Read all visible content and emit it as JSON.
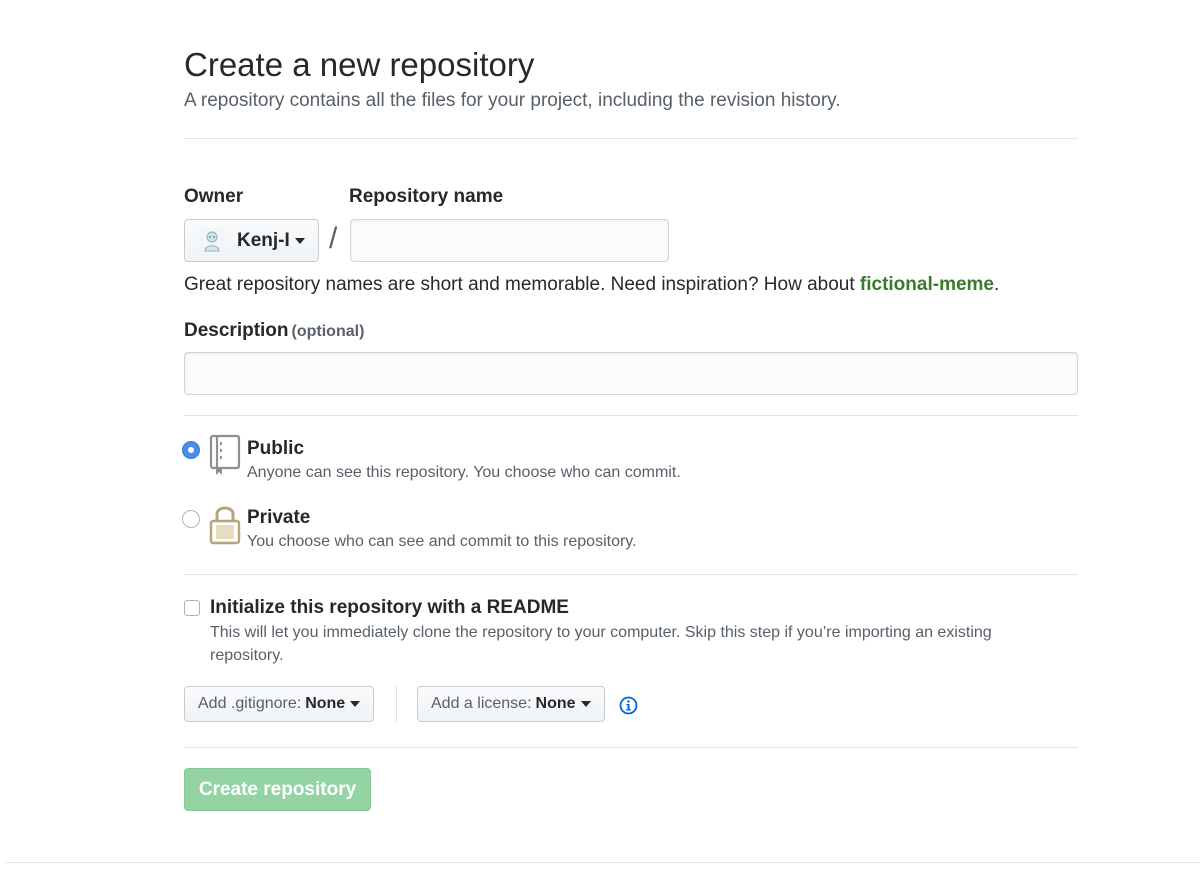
{
  "header": {
    "title": "Create a new repository",
    "subtitle": "A repository contains all the files for your project, including the revision history."
  },
  "owner": {
    "label": "Owner",
    "value": "Kenj-I",
    "avatar_icon": "user-avatar-icon"
  },
  "repo_name": {
    "label": "Repository name",
    "value": "",
    "separator": "/"
  },
  "hint": {
    "prefix": "Great repository names are short and memorable. Need inspiration? How about ",
    "suggestion": "fictional-meme",
    "suffix": "."
  },
  "description": {
    "label": "Description",
    "optional": "(optional)",
    "value": ""
  },
  "visibility": {
    "public": {
      "title": "Public",
      "desc": "Anyone can see this repository. You choose who can commit.",
      "selected": true,
      "icon": "repo-book-icon"
    },
    "private": {
      "title": "Private",
      "desc": "You choose who can see and commit to this repository.",
      "selected": false,
      "icon": "lock-icon"
    }
  },
  "readme": {
    "title": "Initialize this repository with a README",
    "desc": "This will let you immediately clone the repository to your computer. Skip this step if you’re importing an existing repository.",
    "checked": false
  },
  "gitignore": {
    "label": "Add .gitignore:",
    "value": "None"
  },
  "license": {
    "label": "Add a license:",
    "value": "None"
  },
  "submit": {
    "label": "Create repository",
    "disabled": true
  },
  "colors": {
    "radio_selected": "#4a8de6",
    "suggestion": "#3a7a2a",
    "submit_disabled": "#94d3a2",
    "info": "#0366d6"
  }
}
